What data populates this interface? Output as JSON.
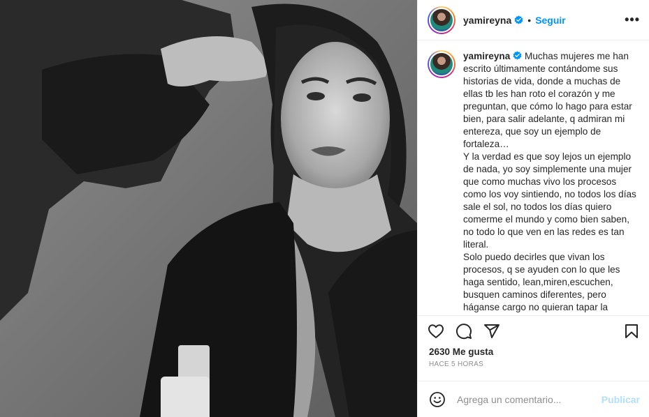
{
  "post": {
    "author": "yamireyna",
    "follow_label": "Seguir",
    "separator": "•",
    "more_label": "•••",
    "verified_icon": "verified-badge-icon",
    "accent_color": "#0095f6"
  },
  "caption": {
    "author": "yamireyna",
    "paragraphs": [
      "Muchas mujeres me han escrito últimamente contándome sus historias de vida, donde a muchas de ellas tb les han roto el corazón y me preguntan, que cómo lo hago para estar bien, para salir adelante, q admiran mi entereza, que soy un ejemplo de fortaleza…",
      "Y la verdad es que soy lejos un ejemplo de nada, yo soy simplemente una mujer que como muchas vivo los procesos como los voy sintiendo, no todos los días sale el sol, no todos los días quiero comerme el mundo y como bien saben, no todo lo que ven en las redes es tan literal.",
      "Solo puedo decirles que vivan los procesos, q se ayuden con lo que les haga sentido, lean,miren,escuchen, busquen caminos diferentes, pero háganse cargo no quieran tapar la"
    ]
  },
  "actions": {
    "icons": [
      "heart-icon",
      "comment-icon",
      "share-icon",
      "bookmark-icon"
    ],
    "likes": "2630 Me gusta",
    "timestamp": "HACE 5 HORAS"
  },
  "add_comment": {
    "placeholder": "Agrega un comentario...",
    "publish_label": "Publicar",
    "publish_color": "#b2dffc"
  }
}
